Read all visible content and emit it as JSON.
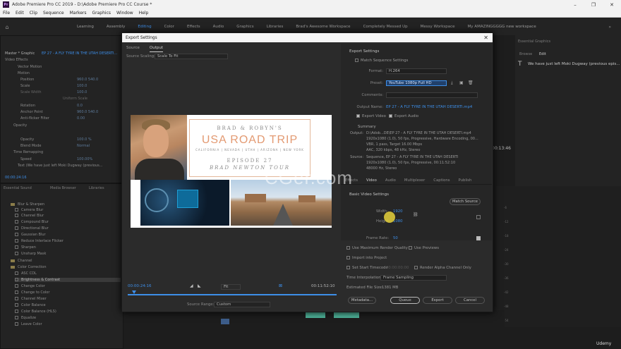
{
  "window": {
    "title": "Adobe Premiere Pro CC 2019 - D:\\Adobe Premiere Pro CC Course *",
    "app_icon": "Pr"
  },
  "menu": [
    "File",
    "Edit",
    "Clip",
    "Sequence",
    "Markers",
    "Graphics",
    "Window",
    "Help"
  ],
  "workspaces": [
    {
      "label": "Learning"
    },
    {
      "label": "Assembly"
    },
    {
      "label": "Editing",
      "active": true
    },
    {
      "label": "Color"
    },
    {
      "label": "Effects"
    },
    {
      "label": "Audio"
    },
    {
      "label": "Graphics"
    },
    {
      "label": "Libraries"
    },
    {
      "label": "Brad's Awesome Workspace"
    },
    {
      "label": "Completely Messed Up"
    },
    {
      "label": "Messy Workspace"
    },
    {
      "label": "My AMAZINGGGGG new workspace"
    }
  ],
  "effect_controls": {
    "header": "Master * Graphic",
    "clip": "EP 27 - A FLY TYRE IN THE UTAH DESERTI...",
    "section": "Video Effects",
    "rows": [
      {
        "label": "Vector Motion"
      },
      {
        "label": "Motion"
      },
      {
        "label": "Position",
        "val": "960.0   540.0"
      },
      {
        "label": "Scale",
        "val": "100.0"
      },
      {
        "label": "Scale Width",
        "val": "100.0"
      },
      {
        "label": "Uniform Scale"
      },
      {
        "label": "Rotation",
        "val": "0.0"
      },
      {
        "label": "Anchor Point",
        "val": "960.0   540.0"
      },
      {
        "label": "Anti-flicker Filter",
        "val": "0.00"
      },
      {
        "label": "Opacity"
      },
      {
        "label": "Opacity",
        "val": "100.0 %"
      },
      {
        "label": "Blend Mode",
        "val": "Normal"
      },
      {
        "label": "Time Remapping"
      },
      {
        "label": "Speed",
        "val": "100.00%"
      },
      {
        "label": "Text (We have just left Moki Dugway (previous..."
      }
    ],
    "timecode": "00:00:24:16"
  },
  "effects_panel": {
    "tabs": [
      "Essential Sound",
      "Media Browser",
      "Libraries"
    ],
    "items": [
      {
        "label": "Blur & Sharpen",
        "folder": true
      },
      {
        "label": "Camera Blur"
      },
      {
        "label": "Channel Blur"
      },
      {
        "label": "Compound Blur"
      },
      {
        "label": "Directional Blur"
      },
      {
        "label": "Gaussian Blur"
      },
      {
        "label": "Reduce Interlace Flicker"
      },
      {
        "label": "Sharpen"
      },
      {
        "label": "Unsharp Mask"
      },
      {
        "label": "Channel",
        "folder": true
      },
      {
        "label": "Color Correction",
        "folder": true
      },
      {
        "label": "ASC CDL"
      },
      {
        "label": "Brightness & Contrast",
        "selected": true
      },
      {
        "label": "Change Color"
      },
      {
        "label": "Change to Color"
      },
      {
        "label": "Channel Mixer"
      },
      {
        "label": "Color Balance"
      },
      {
        "label": "Color Balance (HLS)"
      },
      {
        "label": "Equalize"
      },
      {
        "label": "Leave Color"
      }
    ]
  },
  "dialog": {
    "title": "Export Settings",
    "close": "✕",
    "tabs": [
      "Source",
      "Output"
    ],
    "active_tab": "Output",
    "source_scaling_label": "Source Scaling:",
    "source_scaling_value": "Scale To Fit",
    "preview": {
      "brand": "BRAD & ROBYN'S",
      "headline": "USA ROAD TRIP",
      "states": "CALIFORNIA | NEVADA | UTAH | ARIZONA | NEW YORK",
      "episode": "EPISODE 27",
      "episode_title": "BRAD NEWTON TOUR"
    },
    "timecode_in": "00:00:24:16",
    "timecode_out": "00:11:52:10",
    "fit": "Fit",
    "source_range_label": "Source Range:",
    "source_range_value": "Custom",
    "export_settings": {
      "heading": "Export Settings",
      "match_sequence": "Match Sequence Settings",
      "format_label": "Format:",
      "format": "H.264",
      "preset_label": "Preset:",
      "preset": "YouTube 1080p Full HD",
      "comments_label": "Comments:",
      "output_name_label": "Output Name:",
      "output_name": "EP 27 - A FLY TYRE IN THE UTAH DESERTI.mp4",
      "export_video": "Export Video",
      "export_audio": "Export Audio",
      "summary_heading": "Summary",
      "output_label": "Output:",
      "output_lines": [
        "D:\\Adob...DE\\EP 27 - A FLY TYRE IN THE UTAH DESERTI.mp4",
        "1920x1080 (1.0), 50 fps, Progressive, Hardware Encoding, 00...",
        "VBR, 1 pass, Target 16.00 Mbps",
        "AAC, 320 kbps, 48 kHz, Stereo"
      ],
      "source_label": "Source:",
      "source_lines": [
        "Sequence, EP 27 - A FLY TYRE IN THE UTAH DESERTI",
        "1920x1080 (1.0), 50 fps, Progressive, 00:11:52:10",
        "48000 Hz, Stereo"
      ]
    },
    "settings_tabs": [
      "Effects",
      "Video",
      "Audio",
      "Multiplexer",
      "Captions",
      "Publish"
    ],
    "basic_video": {
      "heading": "Basic Video Settings",
      "match_source": "Match Source",
      "width_label": "Width:",
      "width": "1920",
      "height_label": "Height:",
      "height": "1080",
      "frame_rate_label": "Frame Rate:",
      "frame_rate": "50"
    },
    "options": {
      "max_render": "Use Maximum Render Quality",
      "use_previews": "Use Previews",
      "import_project": "Import into Project",
      "set_start": "Set Start Timecode",
      "start_tc": "00:00:00:00",
      "render_alpha": "Render Alpha Channel Only",
      "time_interp_label": "Time Interpolation:",
      "time_interp": "Frame Sampling",
      "est_size_label": "Estimated File Size:",
      "est_size": "1381 MB"
    },
    "buttons": {
      "metadata": "Metadata...",
      "queue": "Queue",
      "export": "Export",
      "cancel": "Cancel"
    }
  },
  "right_panel": {
    "header": "Essential Graphics",
    "tabs": [
      "Browse",
      "Edit"
    ],
    "text_item": "We have just left Moki Dugway (previous epis...",
    "program_tc": "00:13:46",
    "ruler": [
      "-6",
      "-12",
      "-18",
      "-24",
      "-30",
      "-36",
      "-42",
      "-48",
      "-54"
    ]
  },
  "watermark": "CGer.com",
  "udemy": "Udemy"
}
